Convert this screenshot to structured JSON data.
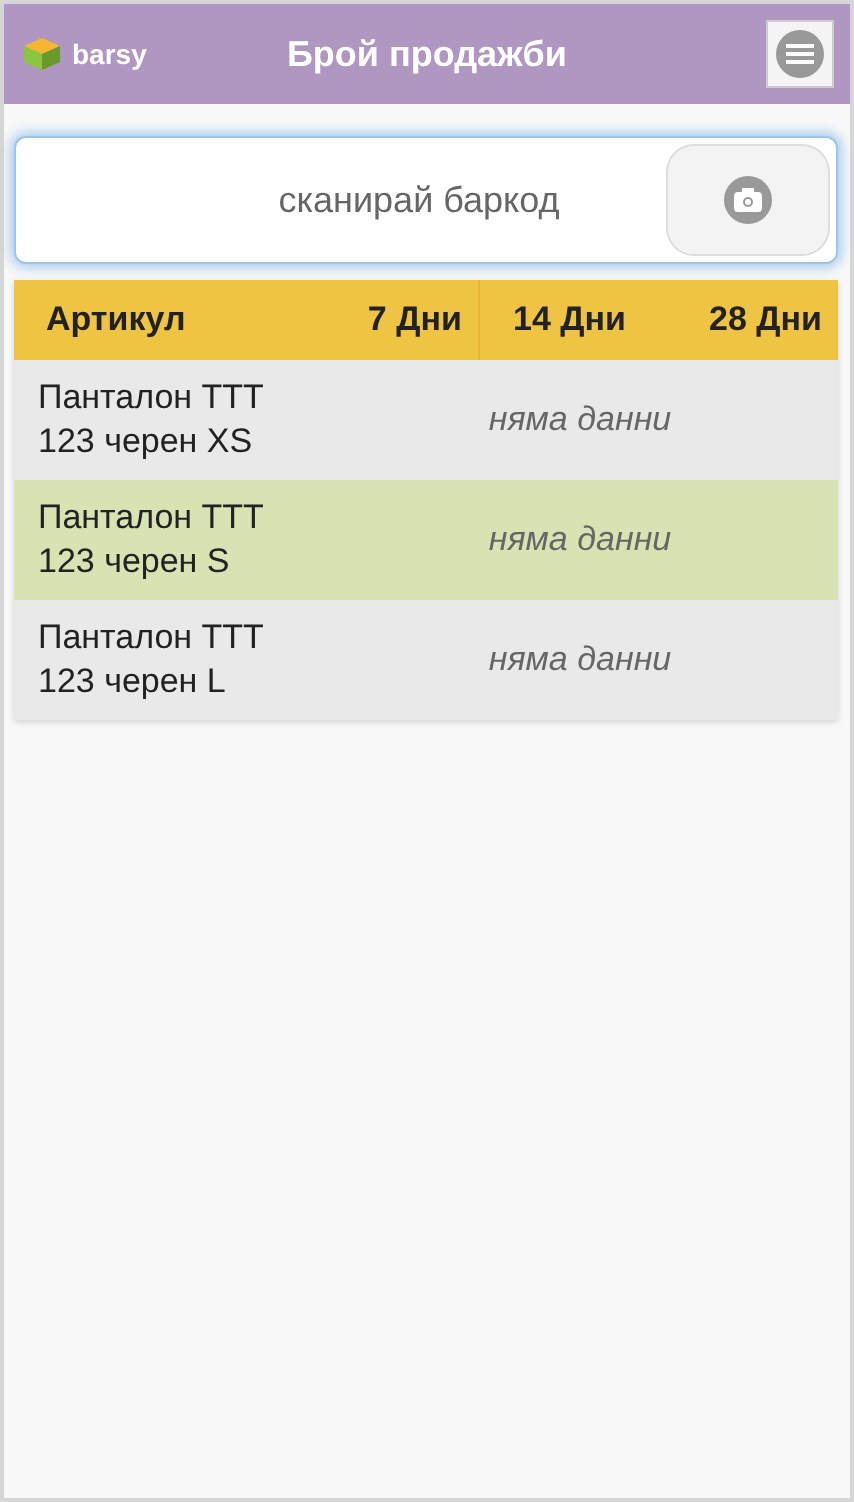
{
  "header": {
    "logo_text": "barsy",
    "title": "Брой продажби"
  },
  "scan": {
    "placeholder": "сканирай баркод",
    "focused": true
  },
  "table": {
    "columns": [
      "Артикул",
      "7 Дни",
      "14 Дни",
      "28 Дни"
    ],
    "rows": [
      {
        "item": "Панталон ТТТ 123 черен XS",
        "note": "няма данни",
        "selected": false
      },
      {
        "item": "Панталон ТТТ 123 черен S",
        "note": "няма данни",
        "selected": true
      },
      {
        "item": "Панталон ТТТ 123 черен L",
        "note": "няма данни",
        "selected": false
      }
    ]
  }
}
